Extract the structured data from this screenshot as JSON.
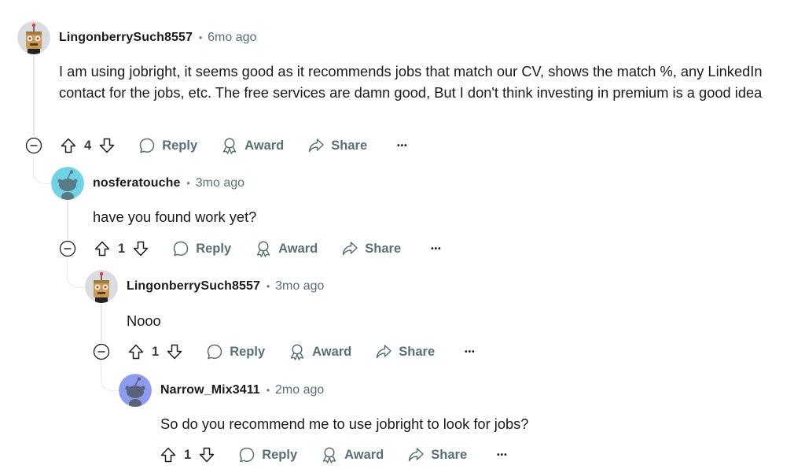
{
  "comments": [
    {
      "author": "LingonberrySuch8557",
      "time": "6mo ago",
      "body": "I am using jobright, it seems good as it recommends jobs that match our CV, shows the match %, any LinkedIn contact for the jobs, etc. The free services are damn good, But I don't think investing in premium is a good idea",
      "votes": "4",
      "avatar_type": "robot"
    },
    {
      "author": "nosferatouche",
      "time": "3mo ago",
      "body": "have you found work yet?",
      "votes": "1",
      "avatar_type": "snoo-cyan"
    },
    {
      "author": "LingonberrySuch8557",
      "time": "3mo ago",
      "body": "Nooo",
      "votes": "1",
      "avatar_type": "robot"
    },
    {
      "author": "Narrow_Mix3411",
      "time": "2mo ago",
      "body": "So do you recommend me to use jobright to look for jobs?",
      "votes": "1",
      "avatar_type": "snoo-blue"
    }
  ],
  "actions": {
    "reply": "Reply",
    "award": "Award",
    "share": "Share",
    "more": "•••"
  },
  "separator": "•",
  "colors": {
    "muted_text": "#576f76",
    "thread_line": "#e5e9ec",
    "avatar_cyan": "#6fd3e6",
    "avatar_blue": "#8e9cf0"
  }
}
